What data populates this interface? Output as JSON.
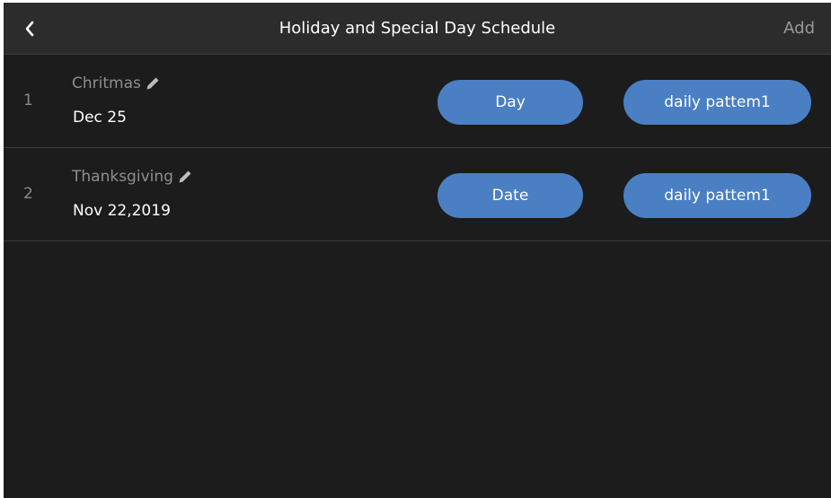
{
  "header": {
    "back_icon": "chevron-left-icon",
    "title": "Holiday and Special Day Schedule",
    "add_label": "Add"
  },
  "rows": [
    {
      "number": "1",
      "name": "Chritmas",
      "edit_icon": "pencil-icon",
      "date": "Dec 25",
      "type_label": "Day",
      "pattern_label": "daily pattem1"
    },
    {
      "number": "2",
      "name": "Thanksgiving",
      "edit_icon": "pencil-icon",
      "date": "Nov 22,2019",
      "type_label": "Date",
      "pattern_label": "daily pattem1"
    }
  ],
  "colors": {
    "background": "#1c1c1c",
    "header_background": "#2c2c2c",
    "accent_button": "#4a7fc3",
    "primary_text": "#ffffff",
    "secondary_text": "#8e8e8e"
  }
}
